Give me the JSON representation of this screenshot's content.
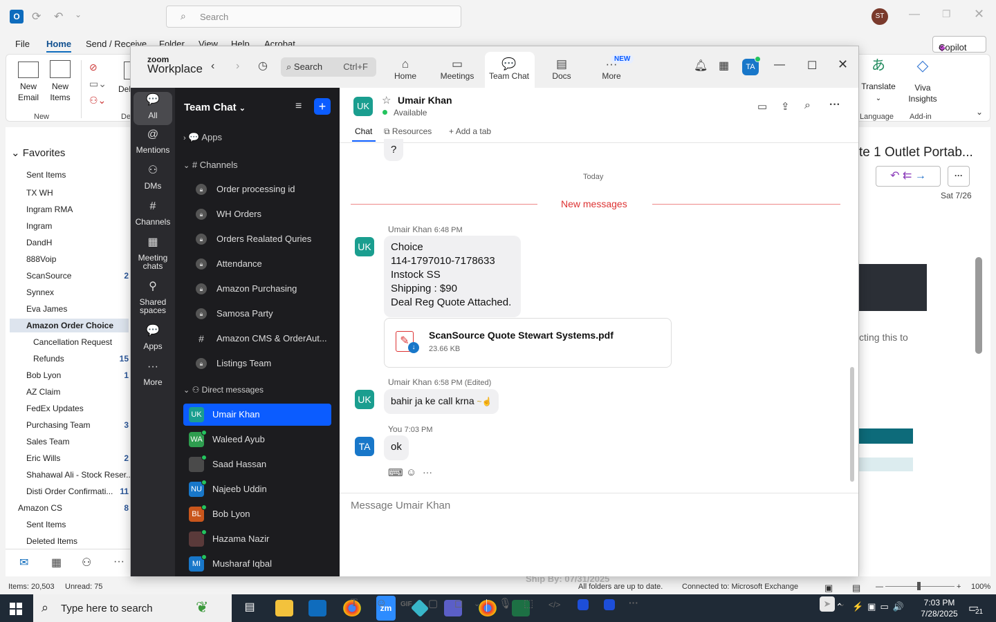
{
  "outlook": {
    "search_placeholder": "Search",
    "avatar_initials": "ST",
    "menu": [
      "File",
      "Home",
      "Send / Receive",
      "Folder",
      "View",
      "Help",
      "Acrobat"
    ],
    "copilot": "Copilot",
    "ribbon": {
      "new_email": "New\nEmail",
      "new_items": "New\nItems",
      "group_new": "New",
      "delete_short": "Del",
      "translate": "Translate",
      "viva": "Viva\nInsights",
      "group_language": "Language",
      "group_addin": "Add-in"
    },
    "favorites_label": "Favorites",
    "folders": [
      {
        "name": "Sent Items",
        "count": ""
      },
      {
        "name": "TX WH",
        "count": ""
      },
      {
        "name": "Ingram RMA",
        "count": ""
      },
      {
        "name": "Ingram",
        "count": ""
      },
      {
        "name": "DandH",
        "count": ""
      },
      {
        "name": "888Voip",
        "count": ""
      },
      {
        "name": "ScanSource",
        "count": "2"
      },
      {
        "name": "Synnex",
        "count": ""
      },
      {
        "name": "Eva James",
        "count": ""
      },
      {
        "name": "Amazon Order Choice",
        "count": ""
      },
      {
        "name": "Cancellation Request",
        "count": ""
      },
      {
        "name": "Refunds",
        "count": "15"
      },
      {
        "name": "Bob Lyon",
        "count": "1"
      },
      {
        "name": "AZ Claim",
        "count": ""
      },
      {
        "name": "FedEx Updates",
        "count": ""
      },
      {
        "name": "Purchasing Team",
        "count": "3"
      },
      {
        "name": "Sales Team",
        "count": ""
      },
      {
        "name": "Eric Wills",
        "count": "2"
      },
      {
        "name": "Shahawal Ali - Stock Reser...",
        "count": ""
      },
      {
        "name": "Disti Order Confirmati...",
        "count": "11"
      },
      {
        "name": "Amazon CS",
        "count": "8"
      },
      {
        "name": "Sent Items",
        "count": ""
      },
      {
        "name": "Deleted Items",
        "count": ""
      }
    ],
    "reading_title": "te 1 Outlet Portab...",
    "reading_date": "Sat 7/26",
    "reading_snippet": "cting this to",
    "status_items": "Items: 20,503",
    "status_unread": "Unread: 75",
    "status_sync": "All folders are up to date.",
    "status_conn": "Connected to: Microsoft Exchange",
    "zoom_pct": "100%",
    "ship_by": "Ship By: 07/31/2025"
  },
  "taskbar": {
    "search_placeholder": "Type here to search",
    "time": "7:03 PM",
    "date": "7/28/2025",
    "notif_count": "21"
  },
  "zoom": {
    "brand_top": "zoom",
    "brand": "Workplace",
    "search_label": "Search",
    "search_shortcut": "Ctrl+F",
    "nav": [
      {
        "label": "Home",
        "icon": "home-icon"
      },
      {
        "label": "Meetings",
        "icon": "video-icon"
      },
      {
        "label": "Team Chat",
        "icon": "chat-icon"
      },
      {
        "label": "Docs",
        "icon": "doc-icon"
      },
      {
        "label": "More",
        "icon": "more-icon"
      }
    ],
    "new_badge": "NEW",
    "profile_initials": "TA",
    "rail": [
      {
        "label": "All",
        "icon": "chat-bubble-icon"
      },
      {
        "label": "Mentions",
        "icon": "at-icon"
      },
      {
        "label": "DMs",
        "icon": "people-icon"
      },
      {
        "label": "Channels",
        "icon": "hash-icon"
      },
      {
        "label": "Meeting chats",
        "icon": "calendar-icon"
      },
      {
        "label": "Shared spaces",
        "icon": "share-icon"
      },
      {
        "label": "Apps",
        "icon": "apps-icon"
      },
      {
        "label": "More",
        "icon": "ellipsis-icon"
      }
    ],
    "sidebar_title": "Team Chat",
    "apps_label": "Apps",
    "channels_label": "Channels",
    "channels": [
      {
        "name": "Order processing id",
        "type": "lock"
      },
      {
        "name": "WH Orders",
        "type": "lock"
      },
      {
        "name": "Orders Realated Quries",
        "type": "lock"
      },
      {
        "name": "Attendance",
        "type": "lock"
      },
      {
        "name": "Amazon Purchasing",
        "type": "lock"
      },
      {
        "name": "Samosa Party",
        "type": "lock"
      },
      {
        "name": "Amazon CMS & OrderAut...",
        "type": "hash"
      },
      {
        "name": "Listings Team",
        "type": "lock"
      }
    ],
    "dm_label": "Direct messages",
    "dms": [
      {
        "name": "Umair Khan",
        "initials": "UK",
        "color": "#1a9e8f",
        "selected": true
      },
      {
        "name": "Waleed Ayub",
        "initials": "WA",
        "color": "#2e9d4f",
        "selected": false
      },
      {
        "name": "Saad Hassan",
        "initials": "",
        "color": "#4a4a4a",
        "selected": false
      },
      {
        "name": "Najeeb Uddin",
        "initials": "NU",
        "color": "#1877c9",
        "selected": false
      },
      {
        "name": "Bob Lyon",
        "initials": "BL",
        "color": "#c9561c",
        "selected": false
      },
      {
        "name": "Hazama Nazir",
        "initials": "",
        "color": "#5a3a3a",
        "selected": false
      },
      {
        "name": "Musharaf Iqbal",
        "initials": "MI",
        "color": "#1877c9",
        "selected": false
      }
    ],
    "chat": {
      "contact_name": "Umair Khan",
      "contact_initials": "UK",
      "status": "Available",
      "tabs": [
        "Chat",
        "Resources",
        "Add a tab"
      ],
      "prev_msg": "?",
      "day_divider": "Today",
      "new_messages": "New messages",
      "messages": [
        {
          "sender": "Umair Khan",
          "time": "6:48 PM",
          "lines": [
            "Choice",
            "114-1797010-7178633",
            "Instock SS",
            "Shipping : $90",
            "Deal Reg Quote Attached."
          ]
        },
        {
          "sender": "Umair Khan",
          "time": "6:58 PM (Edited)",
          "lines": [
            "bahir ja ke call krna"
          ]
        },
        {
          "sender": "You",
          "time": "7:03 PM",
          "lines": [
            "ok"
          ]
        }
      ],
      "attachment_name": "ScanSource Quote Stewart Systems.pdf",
      "attachment_size": "23.66 KB",
      "composer_placeholder": "Message Umair Khan",
      "composer_tools": [
        "T",
        "☺",
        "GIF",
        "▢",
        "◻",
        "⌄",
        "🎙",
        "⬚",
        "</>",
        "◙",
        "◙",
        "···"
      ]
    }
  }
}
